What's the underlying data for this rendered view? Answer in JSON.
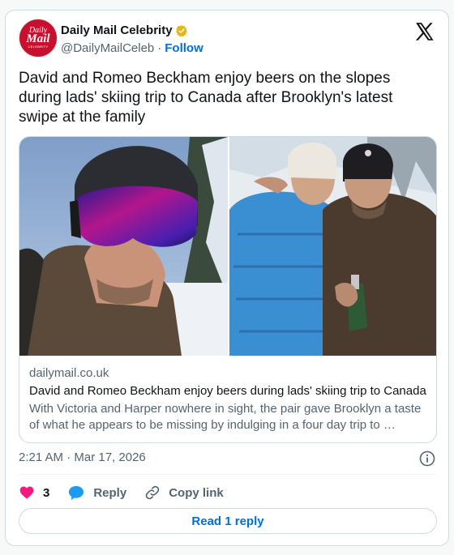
{
  "account": {
    "display_name": "Daily Mail Celebrity",
    "handle": "@DailyMailCeleb",
    "separator": "·",
    "follow_label": "Follow",
    "avatar_line1": "Daily",
    "avatar_line2": "Mail",
    "avatar_line3": "CELEBRITY",
    "avatar_color": "#c8102e",
    "verified_color": "#e2b719"
  },
  "tweet": {
    "text": "David and Romeo Beckham enjoy beers on the slopes during lads' skiing trip to Canada after Brooklyn's latest swipe at the family"
  },
  "link_card": {
    "domain": "dailymail.co.uk",
    "title": "David and Romeo Beckham enjoy beers during lads' skiing trip to Canada",
    "description": "With Victoria and Harper nowhere in sight, the pair gave Brooklyn a taste of what he appears to be missing by indulging in a four day trip to …"
  },
  "meta": {
    "timestamp": "2:21 AM · Mar 17, 2026"
  },
  "actions": {
    "like_count": "3",
    "reply_label": "Reply",
    "copy_link_label": "Copy link",
    "read_replies_label": "Read 1 reply"
  },
  "icons": {
    "like": "heart-icon",
    "reply": "speech-bubble-icon",
    "copy": "link-icon",
    "info": "info-icon",
    "platform": "x-logo-icon"
  },
  "colors": {
    "accent": "#006fd6",
    "like": "#f91880",
    "reply": "#1d9bf0",
    "muted": "#536471"
  }
}
